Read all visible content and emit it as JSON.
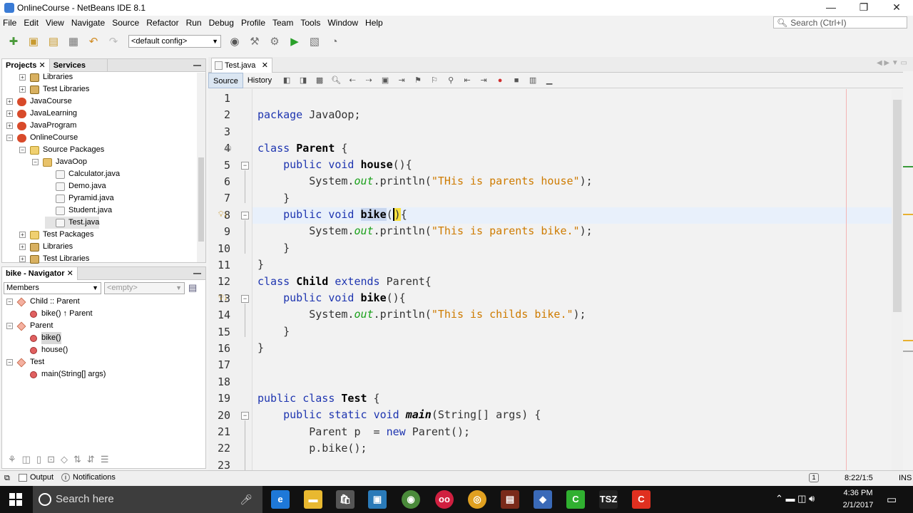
{
  "window": {
    "title": "OnlineCourse - NetBeans IDE 8.1",
    "minimize": "—",
    "maximize": "❐",
    "close": "✕"
  },
  "menu": [
    "File",
    "Edit",
    "View",
    "Navigate",
    "Source",
    "Refactor",
    "Run",
    "Debug",
    "Profile",
    "Team",
    "Tools",
    "Window",
    "Help"
  ],
  "search": {
    "placeholder": "Search (Ctrl+I)"
  },
  "toolbar": {
    "config": "<default config>"
  },
  "projects_panel": {
    "tabs": [
      "Projects",
      "Services"
    ],
    "rows": [
      {
        "label": "Libraries",
        "indent": 1,
        "icon": "lib",
        "exp": "+"
      },
      {
        "label": "Test Libraries",
        "indent": 1,
        "icon": "lib",
        "exp": "+"
      },
      {
        "label": "JavaCourse",
        "indent": 0,
        "icon": "cup",
        "exp": "+"
      },
      {
        "label": "JavaLearning",
        "indent": 0,
        "icon": "cup",
        "exp": "+"
      },
      {
        "label": "JavaProgram",
        "indent": 0,
        "icon": "cup",
        "exp": "+"
      },
      {
        "label": "OnlineCourse",
        "indent": 0,
        "icon": "cup",
        "exp": "−"
      },
      {
        "label": "Source Packages",
        "indent": 1,
        "icon": "folder",
        "exp": "−"
      },
      {
        "label": "JavaOop",
        "indent": 2,
        "icon": "pkg",
        "exp": "−"
      },
      {
        "label": "Calculator.java",
        "indent": 3,
        "icon": "file",
        "exp": ""
      },
      {
        "label": "Demo.java",
        "indent": 3,
        "icon": "file",
        "exp": ""
      },
      {
        "label": "Pyramid.java",
        "indent": 3,
        "icon": "file",
        "exp": ""
      },
      {
        "label": "Student.java",
        "indent": 3,
        "icon": "file",
        "exp": ""
      },
      {
        "label": "Test.java",
        "indent": 3,
        "icon": "file",
        "exp": ""
      },
      {
        "label": "Test Packages",
        "indent": 1,
        "icon": "folder",
        "exp": "+"
      },
      {
        "label": "Libraries",
        "indent": 1,
        "icon": "lib",
        "exp": "+"
      },
      {
        "label": "Test Libraries",
        "indent": 1,
        "icon": "lib",
        "exp": "+"
      }
    ]
  },
  "navigator": {
    "title": "bike - Navigator",
    "members_label": "Members",
    "filter_placeholder": "<empty>",
    "rows": [
      {
        "label": "Child :: Parent",
        "indent": 0,
        "kind": "class",
        "exp": "−"
      },
      {
        "label": "bike() ↑ Parent",
        "indent": 1,
        "kind": "method",
        "exp": ""
      },
      {
        "label": "Parent",
        "indent": 0,
        "kind": "class",
        "exp": "−"
      },
      {
        "label": "bike()",
        "indent": 1,
        "kind": "method",
        "exp": ""
      },
      {
        "label": "house()",
        "indent": 1,
        "kind": "method",
        "exp": ""
      },
      {
        "label": "Test",
        "indent": 0,
        "kind": "class",
        "exp": "−"
      },
      {
        "label": "main(String[] args)",
        "indent": 1,
        "kind": "method",
        "exp": ""
      }
    ]
  },
  "editor": {
    "tab": "Test.java",
    "source_tab": "Source",
    "history_tab": "History",
    "line_numbers": [
      "1",
      "2",
      "3",
      "4",
      "5",
      "6",
      "7",
      "8",
      "9",
      "10",
      "11",
      "12",
      "13",
      "14",
      "15",
      "16",
      "17",
      "18",
      "19",
      "20",
      "21",
      "22",
      "23"
    ]
  },
  "status": {
    "output": "Output",
    "notifications": "Notifications",
    "position": "8:22/1:5",
    "mode": "INS"
  },
  "taskbar": {
    "search": "Search here",
    "time": "4:36 PM",
    "date": "2/1/2017"
  },
  "colors": {
    "keyword": "#1e35b0",
    "string": "#ce7b00",
    "field": "#18a018"
  }
}
